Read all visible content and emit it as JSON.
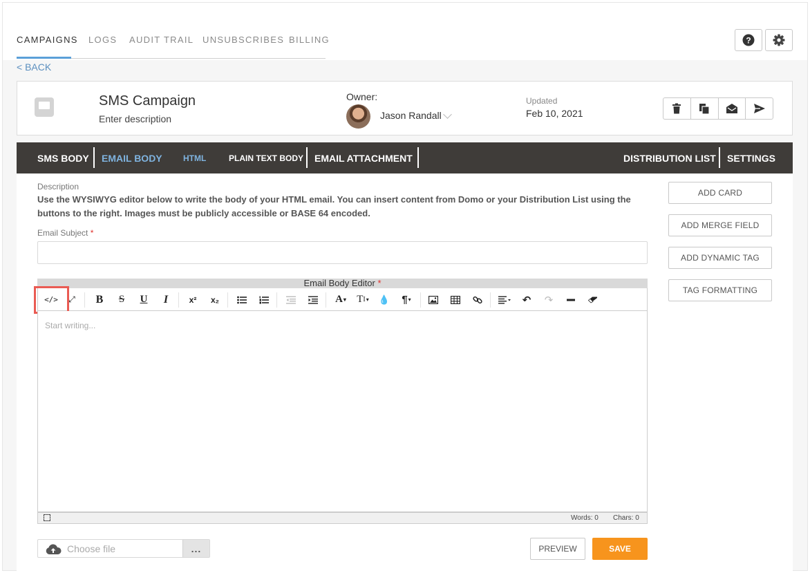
{
  "nav": {
    "tabs": [
      {
        "label": "CAMPAIGNS",
        "active": true
      },
      {
        "label": "LOGS"
      },
      {
        "label": "AUDIT TRAIL"
      },
      {
        "label": "UNSUBSCRIBES"
      },
      {
        "label": "BILLING"
      }
    ],
    "help_icon": "question-circle-icon",
    "settings_icon": "gear-icon"
  },
  "back_label": "< BACK",
  "campaign": {
    "title": "SMS Campaign",
    "description": "Enter description",
    "owner_label": "Owner:",
    "owner_name": "Jason Randall",
    "updated_label": "Updated",
    "updated_value": "Feb 10, 2021",
    "actions": [
      "trash-icon",
      "copy-icon",
      "envelope-open-icon",
      "send-icon"
    ]
  },
  "tabs": {
    "sms_body": "SMS BODY",
    "email_body": "EMAIL BODY",
    "html": "HTML",
    "plain_text_body": "PLAIN TEXT BODY",
    "email_attachment": "EMAIL ATTACHMENT",
    "distribution_list": "DISTRIBUTION LIST",
    "settings": "SETTINGS"
  },
  "form": {
    "description_label": "Description",
    "description_text": "Use the WYSIWYG editor below to write the body of your HTML email. You can insert content from Domo or your Distribution List using the buttons to the right. Images must be publicly accessible or BASE 64 encoded.",
    "subject_label": "Email Subject",
    "required_mark": "*",
    "editor_label": "Email Body Editor",
    "editor_placeholder": "Start writing...",
    "words": "Words: 0",
    "chars": "Chars: 0",
    "file_placeholder": "Choose file",
    "file_button": "..."
  },
  "side_buttons": [
    "ADD CARD",
    "ADD MERGE FIELD",
    "ADD DYNAMIC TAG",
    "TAG FORMATTING"
  ],
  "footer": {
    "preview": "PREVIEW",
    "save": "SAVE"
  },
  "colors": {
    "accent": "#5ba0d8",
    "tabbar": "#3f3c39",
    "save": "#f7941d",
    "highlight": "#ea5b53",
    "required": "#e0302c"
  }
}
